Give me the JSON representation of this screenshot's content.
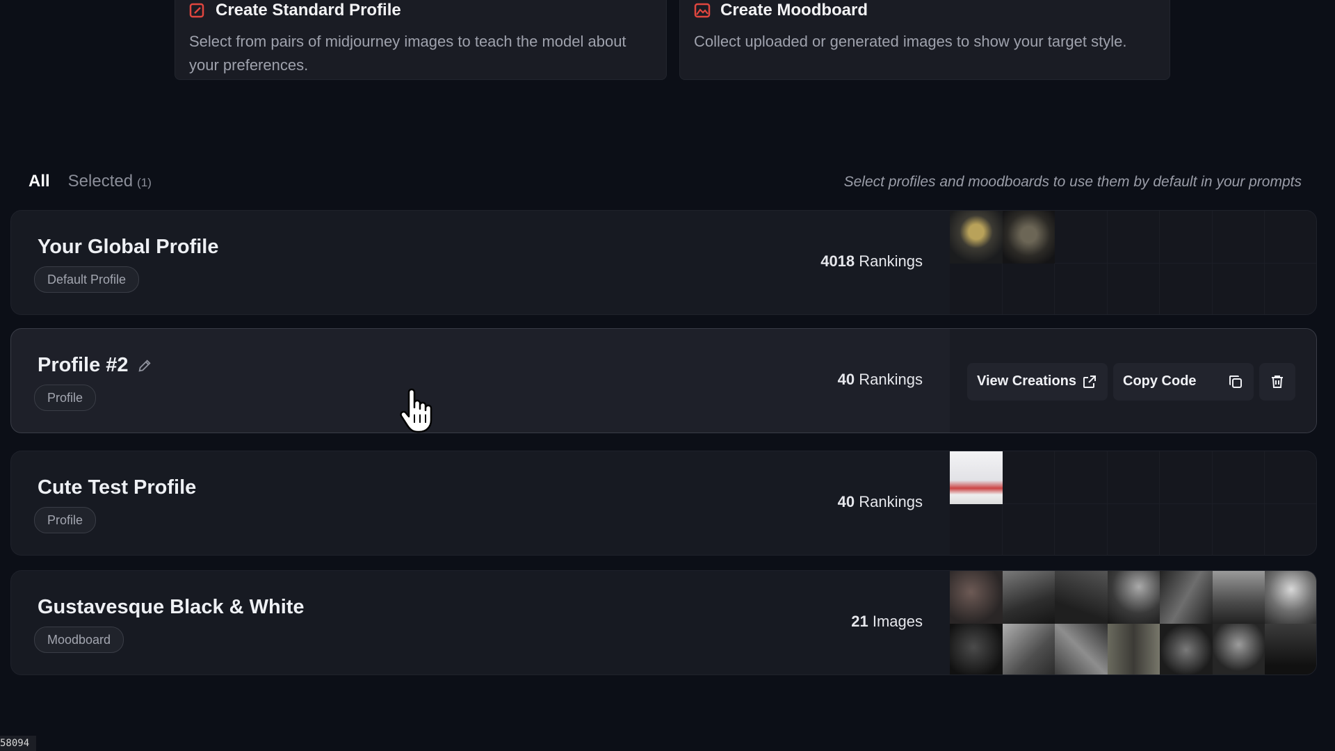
{
  "cards": [
    {
      "title": "Create Standard Profile",
      "desc": "Select from pairs of midjourney images to teach the model about your preferences."
    },
    {
      "title": "Create Moodboard",
      "desc": "Collect uploaded or generated images to show your target style."
    }
  ],
  "tabs": {
    "all": "All",
    "selected": "Selected",
    "selected_count": "(1)"
  },
  "hint": "Select profiles and moodboards to use them by default in your prompts",
  "rows": [
    {
      "title": "Your Global Profile",
      "badge": "Default Profile",
      "count": "4018",
      "unit": "Rankings"
    },
    {
      "title": "Profile #2",
      "badge": "Profile",
      "count": "40",
      "unit": "Rankings"
    },
    {
      "title": "Cute Test Profile",
      "badge": "Profile",
      "count": "40",
      "unit": "Rankings"
    },
    {
      "title": "Gustavesque Black & White",
      "badge": "Moodboard",
      "count": "21",
      "unit": "Images"
    }
  ],
  "actions": {
    "view_creations": "View Creations",
    "copy_code": "Copy Code"
  },
  "corner_text": "58094",
  "colors": {
    "accent": "#e0463f",
    "background": "#0c0f17",
    "row": "#171a22"
  }
}
